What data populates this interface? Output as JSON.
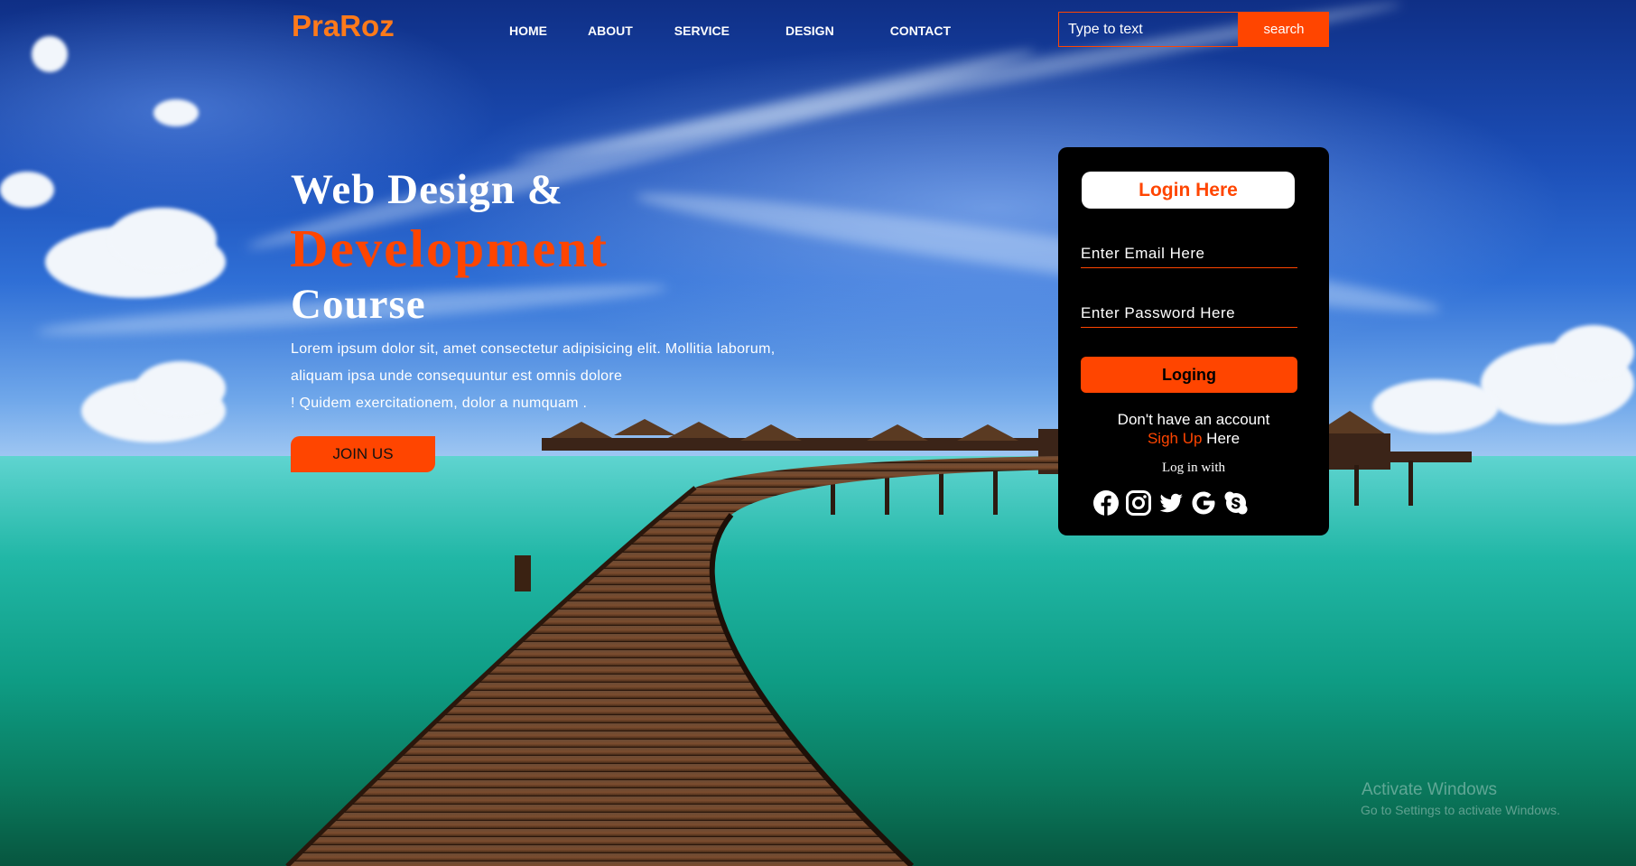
{
  "header": {
    "logo": "PraRoz",
    "nav": [
      "HOME",
      "ABOUT",
      "SERVICE",
      "DESIGN",
      "CONTACT"
    ],
    "search_placeholder": "Type to text",
    "search_label": "search"
  },
  "hero": {
    "line1": "Web Design &",
    "line2": "Development",
    "line3": "Course",
    "desc": [
      "Lorem ipsum dolor sit, amet consectetur adipisicing elit. Mollitia laborum,",
      "aliquam ipsa unde consequuntur est omnis dolore",
      "! Quidem exercitationem, dolor a numquam ."
    ],
    "join_label": "JOIN US"
  },
  "login": {
    "title": "Login Here",
    "email_placeholder": "Enter Email Here",
    "password_placeholder": "Enter Password Here",
    "button_label": "Loging",
    "no_account": "Don't have an account",
    "signup_link": "Sigh Up",
    "signup_suffix": " Here",
    "login_with": "Log in with",
    "socials": [
      "facebook-icon",
      "instagram-icon",
      "twitter-icon",
      "google-icon",
      "skype-icon"
    ]
  },
  "watermark": {
    "line1": "Activate Windows",
    "line2": "Go to Settings to activate Windows."
  },
  "colors": {
    "accent": "#ff4500",
    "logo": "#ff7a1a",
    "panel": "#000000"
  }
}
